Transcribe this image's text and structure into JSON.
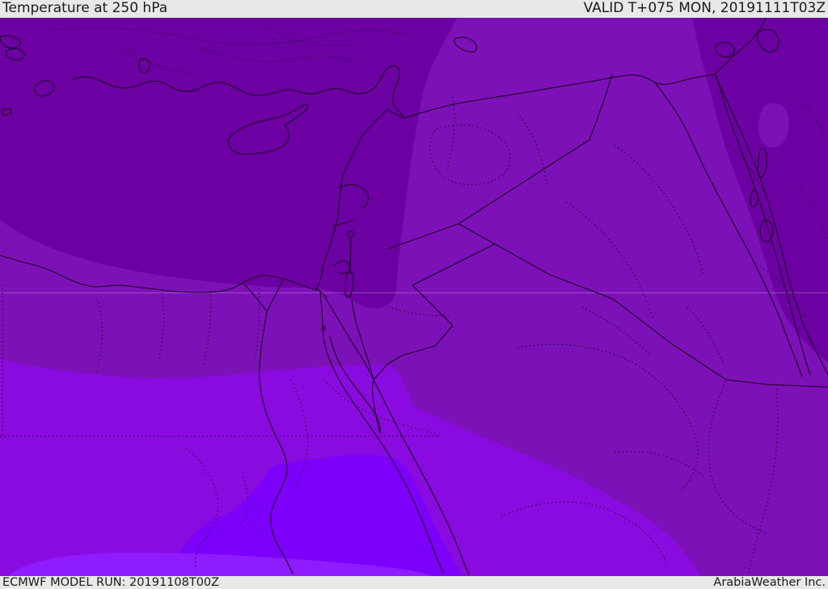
{
  "header": {
    "title": "Temperature at 250 hPa",
    "valid_time": "VALID T+075 MON, 20191111T03Z"
  },
  "footer": {
    "model_run": "ECMWF MODEL RUN: 20191108T00Z",
    "credit": "ArabiaWeather Inc."
  },
  "map": {
    "parameter": "Temperature",
    "pressure_level": "250 hPa",
    "frame_background": "#e9e8e8",
    "text_color": "#1a1a1a",
    "line_color": "#1c0322",
    "grid_line_color": "rgba(255,255,255,0.25)",
    "bands": [
      {
        "name": "band-north-darkest",
        "color": "#6C00A3"
      },
      {
        "name": "band-mid-dark",
        "color": "#7D11B8"
      },
      {
        "name": "band-mid-bright",
        "color": "#8A0BE0"
      },
      {
        "name": "band-south-bright",
        "color": "#7C00FA"
      },
      {
        "name": "band-south-lightest",
        "color": "#8F1BFF"
      }
    ]
  }
}
